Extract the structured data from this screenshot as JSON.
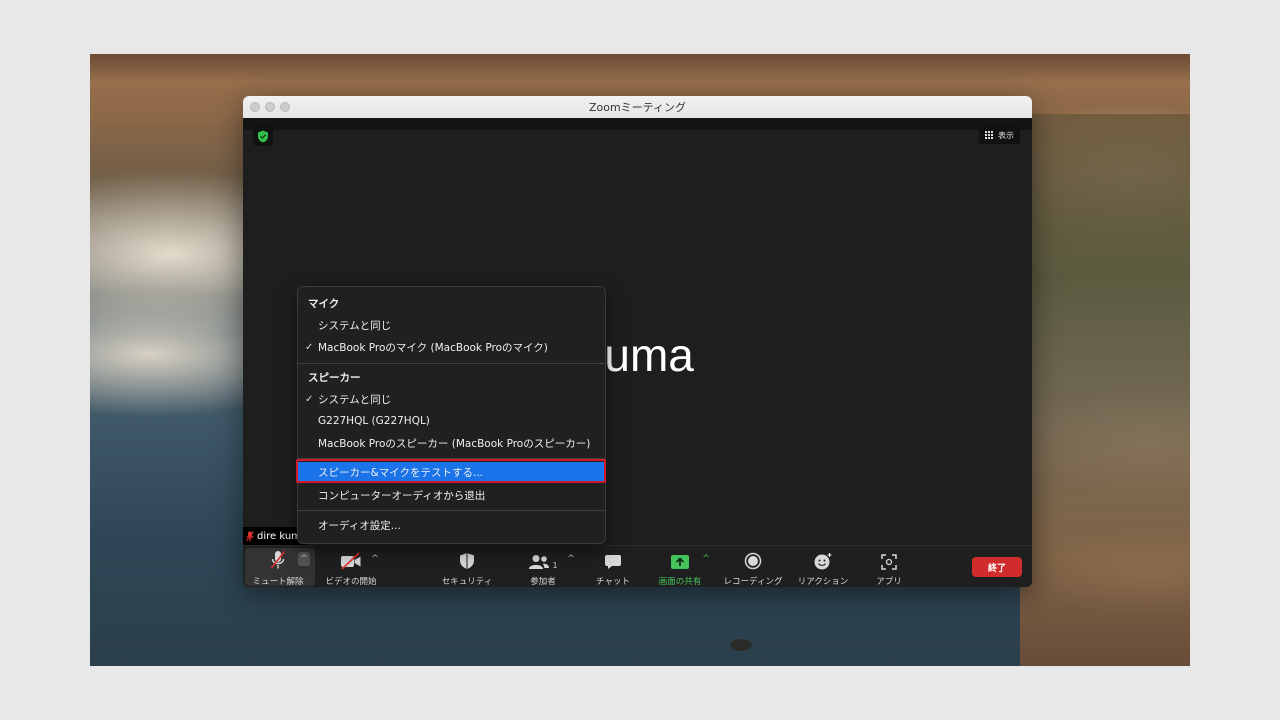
{
  "window": {
    "title": "Zoomミーティング"
  },
  "video": {
    "view_label": "表示",
    "participant_display_name": "e kuma",
    "participant_name_label": "dire kum"
  },
  "audio_menu": {
    "mic_header": "マイク",
    "mic_options": [
      {
        "label": "システムと同じ",
        "checked": false
      },
      {
        "label": "MacBook Proのマイク (MacBook Proのマイク)",
        "checked": true
      }
    ],
    "speaker_header": "スピーカー",
    "speaker_options": [
      {
        "label": "システムと同じ",
        "checked": true
      },
      {
        "label": "G227HQL (G227HQL)",
        "checked": false
      },
      {
        "label": "MacBook Proのスピーカー (MacBook Proのスピーカー)",
        "checked": false
      }
    ],
    "test_label": "スピーカー&マイクをテストする...",
    "leave_label": "コンピューターオーディオから退出",
    "settings_label": "オーディオ設定...",
    "checkmark": "✓",
    "highlight_color": "#1a73e8",
    "annotation_color": "#d0192b"
  },
  "toolbar": {
    "unmute": "ミュート解除",
    "start_video": "ビデオの開始",
    "security": "セキュリティ",
    "participants": "参加者",
    "participants_count": "1",
    "chat": "チャット",
    "share_screen": "画面の共有",
    "recording": "レコーディング",
    "reactions": "リアクション",
    "apps": "アプリ",
    "end": "終了",
    "end_color": "#d12c2c",
    "share_color": "#45c45d"
  }
}
